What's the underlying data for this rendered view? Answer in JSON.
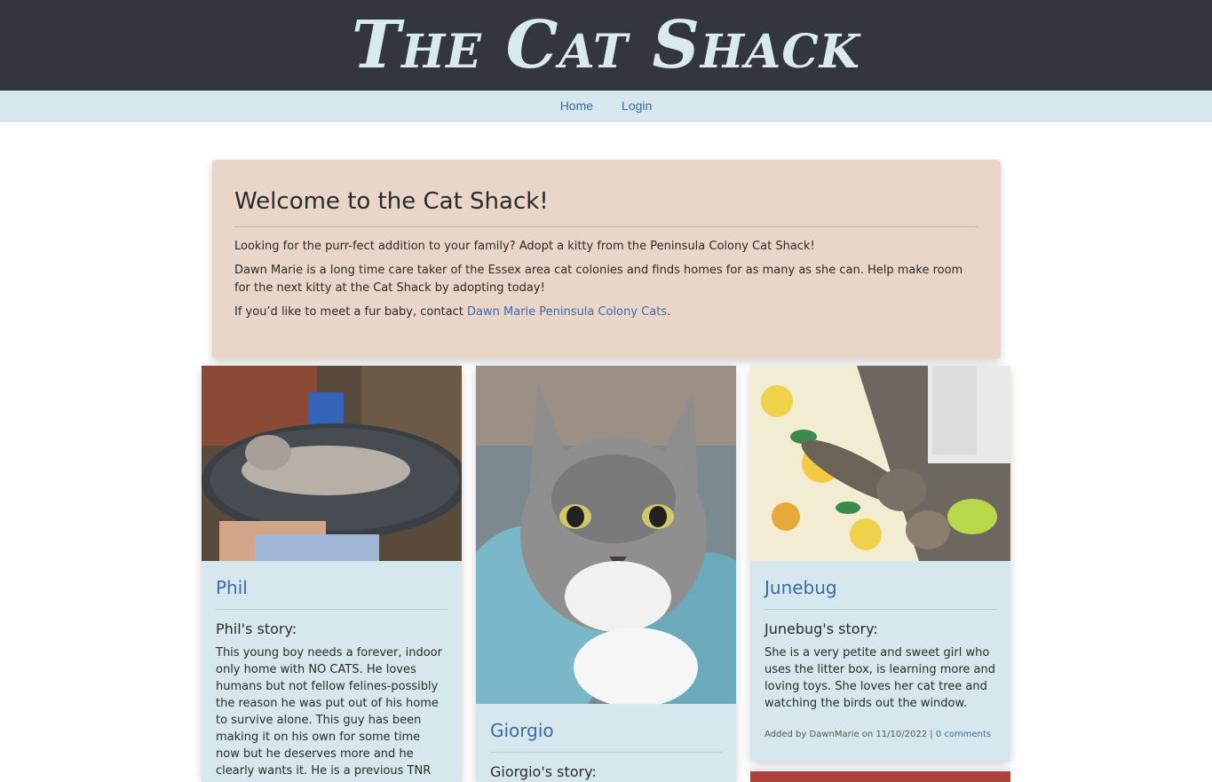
{
  "header": {
    "title": "The Cat Shack"
  },
  "nav": {
    "home": "Home",
    "login": "Login"
  },
  "welcome": {
    "heading": "Welcome to the Cat Shack!",
    "p1": "Looking for the purr-fect addition to your family? Adopt a kitty from the Peninsula Colony Cat Shack!",
    "p2": "Dawn Marie is a long time care taker of the Essex area cat colonies and finds homes for as many as she can. Help make room for the next kitty at the Cat Shack by adopting today!",
    "p3_prefix": "If you’d like to meet a fur baby, contact ",
    "p3_link": "Dawn Marie Peninsula Colony Cats",
    "p3_suffix": "."
  },
  "cats": [
    {
      "name": "Phil",
      "story_heading": "Phil's story:",
      "story": "This young boy needs a forever, indoor only home with NO CATS. He loves humans but not fellow felines-possibly the reason he was put out of his home to survive alone. This guy has been making it on his own for some time now but he deserves more and he clearly wants it. He is a previous TNR"
    },
    {
      "name": "Giorgio",
      "story_heading": "Giorgio's story:"
    },
    {
      "name": "Junebug",
      "story_heading": "Junebug's story:",
      "story": "She is a very petite and sweet girl who uses the litter box, is learning more and loving toys. She loves her cat tree and watching the birds out the window.",
      "meta_prefix": "Added by DawnMarie on 11/10/2022 | ",
      "meta_link": "0 comments"
    }
  ]
}
